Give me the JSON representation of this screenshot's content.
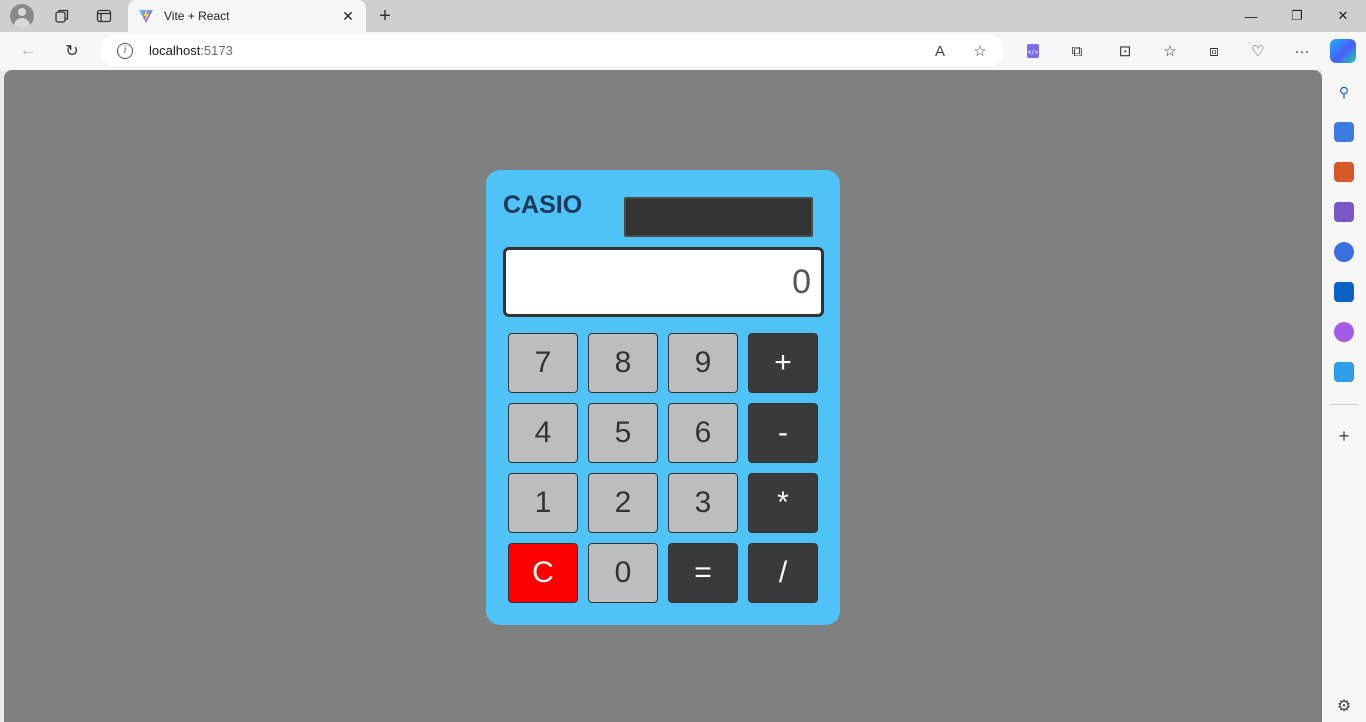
{
  "browser": {
    "tab": {
      "title": "Vite + React",
      "close_glyph": "✕"
    },
    "new_tab_glyph": "+",
    "window_controls": {
      "minimize": "—",
      "restore": "❐",
      "close": "✕"
    },
    "address": {
      "host": "localhost",
      "port": ":5173"
    },
    "nav": {
      "back": "←",
      "refresh": "↻",
      "more": "···"
    },
    "address_icons": {
      "read_aloud": "A",
      "favorite": "☆"
    },
    "toolbar_icons": {
      "extensions": "⧉",
      "split": "⊡",
      "favorites": "☆",
      "collections": "⧈",
      "health": "♡"
    }
  },
  "sidebar": {
    "icons": [
      "search-icon",
      "shopping-icon",
      "tools-icon",
      "games-icon",
      "microsoft365-icon",
      "outlook-icon",
      "designer-icon",
      "send-icon"
    ],
    "add_glyph": "+",
    "settings_glyph": "⚙"
  },
  "calculator": {
    "brand": "CASIO",
    "display": "0",
    "keys": [
      {
        "label": "7",
        "kind": "num"
      },
      {
        "label": "8",
        "kind": "num"
      },
      {
        "label": "9",
        "kind": "num"
      },
      {
        "label": "+",
        "kind": "op"
      },
      {
        "label": "4",
        "kind": "num"
      },
      {
        "label": "5",
        "kind": "num"
      },
      {
        "label": "6",
        "kind": "num"
      },
      {
        "label": "-",
        "kind": "op"
      },
      {
        "label": "1",
        "kind": "num"
      },
      {
        "label": "2",
        "kind": "num"
      },
      {
        "label": "3",
        "kind": "num"
      },
      {
        "label": "*",
        "kind": "op"
      },
      {
        "label": "C",
        "kind": "clear"
      },
      {
        "label": "0",
        "kind": "num"
      },
      {
        "label": "=",
        "kind": "op"
      },
      {
        "label": "/",
        "kind": "op"
      }
    ]
  },
  "colors": {
    "page_background": "#808080",
    "calculator_body": "#4fc3f7",
    "brand_text": "#1c3a5a",
    "number_key": "#bdbdbd",
    "operator_key": "#3a3a3a",
    "clear_key": "#ff0000"
  }
}
